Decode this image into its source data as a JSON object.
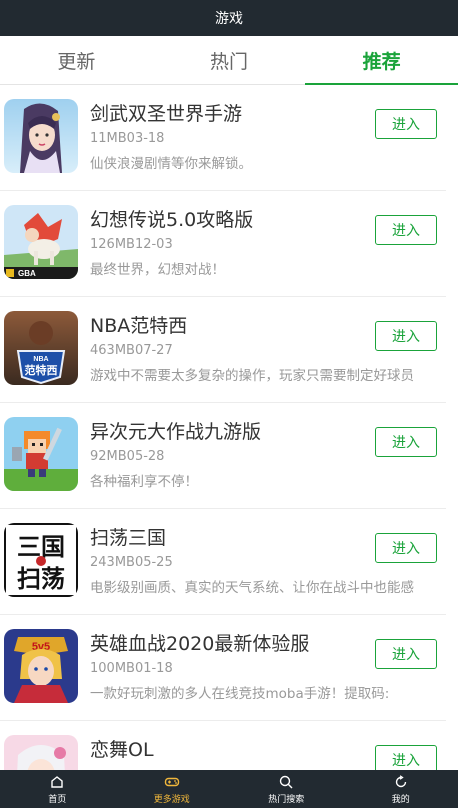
{
  "header": {
    "title": "游戏"
  },
  "tabs": [
    {
      "label": "更新"
    },
    {
      "label": "热门"
    },
    {
      "label": "推荐"
    }
  ],
  "active_tab": "推荐",
  "accent_color": "#1aa33a",
  "games": [
    {
      "name": "剑武双圣世界手游",
      "meta": "11MB03-18",
      "desc": "仙侠浪漫剧情等你来解锁。",
      "button": "进入",
      "icon": "fantasy-girl-icon"
    },
    {
      "name": "幻想传说5.0攻略版",
      "meta": "126MB12-03",
      "desc": "最终世界，幻想对战！",
      "button": "进入",
      "icon": "fantasy-knight-gba-icon"
    },
    {
      "name": "NBA范特西",
      "meta": "463MB07-27",
      "desc": "游戏中不需要太多复杂的操作，玩家只需要制定好球员",
      "button": "进入",
      "icon": "nba-fantasy-icon"
    },
    {
      "name": "异次元大作战九游版",
      "meta": "92MB05-28",
      "desc": "各种福利享不停！",
      "button": "进入",
      "icon": "pixel-warrior-icon"
    },
    {
      "name": "扫荡三国",
      "meta": "243MB05-25",
      "desc": "电影级别画质、真实的天气系统、让你在战斗中也能感",
      "button": "进入",
      "icon": "three-kingdoms-calligraphy-icon"
    },
    {
      "name": "英雄血战2020最新体验服",
      "meta": "100MB01-18",
      "desc": "一款好玩刺激的多人在线竞技moba手游！提取码:",
      "button": "进入",
      "icon": "moba-5v5-hero-icon"
    },
    {
      "name": "恋舞OL",
      "meta": "",
      "desc": "",
      "button": "进入",
      "icon": "dance-girl-icon"
    }
  ],
  "icon_texts": {
    "gba": "GBA",
    "nba": "NBA",
    "fantasy": "范特西",
    "sanguo": "三国",
    "saodang": "扫荡",
    "vs": "5v5"
  },
  "bottom_nav": [
    {
      "label": "首页",
      "icon": "home-icon"
    },
    {
      "label": "更多游戏",
      "icon": "gamepad-icon"
    },
    {
      "label": "热门搜索",
      "icon": "search-icon"
    },
    {
      "label": "我的",
      "icon": "refresh-icon"
    }
  ],
  "active_nav": "更多游戏"
}
